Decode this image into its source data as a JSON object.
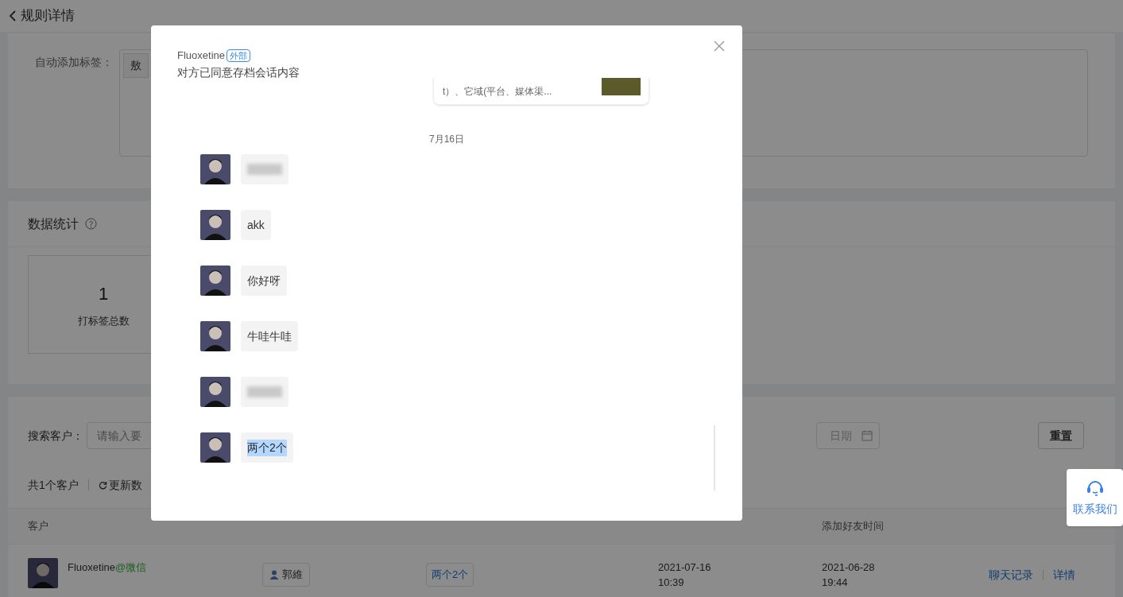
{
  "header": {
    "title": "规则详情"
  },
  "rule_card": {
    "label": "自动添加标签：",
    "tag": "敖"
  },
  "stats": {
    "title": "数据统计",
    "cards": [
      {
        "value": "1",
        "label": "打标签总数"
      }
    ]
  },
  "customers": {
    "search_label": "搜索客户：",
    "search_placeholder": "请输入要",
    "date_placeholder": "日期",
    "reset": "重置",
    "count": "共1个客户",
    "refresh": "更新数",
    "columns": [
      "客户",
      "添加好友时间"
    ],
    "rows": [
      {
        "name": "Fluoxetine",
        "source": "@微信",
        "employee": "郭維",
        "tag": "两个2个",
        "tag_time": "2021-07-16\n10:39",
        "add_time": "2021-06-28\n19:44",
        "actions": [
          "聊天记录",
          "详情"
        ]
      }
    ]
  },
  "contact": {
    "label": "联系我们"
  },
  "dialog": {
    "name": "Fluoxetine",
    "badge": "外部",
    "subtitle": "对方已同意存档会话内容",
    "link_card": {
      "text": "t）、它域(平台、媒体渠..."
    },
    "date": "7月16日",
    "messages": [
      {
        "kind": "blurred"
      },
      {
        "kind": "text",
        "text": "akk",
        "highlighted": false
      },
      {
        "kind": "text",
        "text": "你好呀",
        "highlighted": false
      },
      {
        "kind": "text",
        "text": "牛哇牛哇",
        "highlighted": false
      },
      {
        "kind": "blurred"
      },
      {
        "kind": "text",
        "text": "两个2个",
        "highlighted": true
      }
    ]
  }
}
